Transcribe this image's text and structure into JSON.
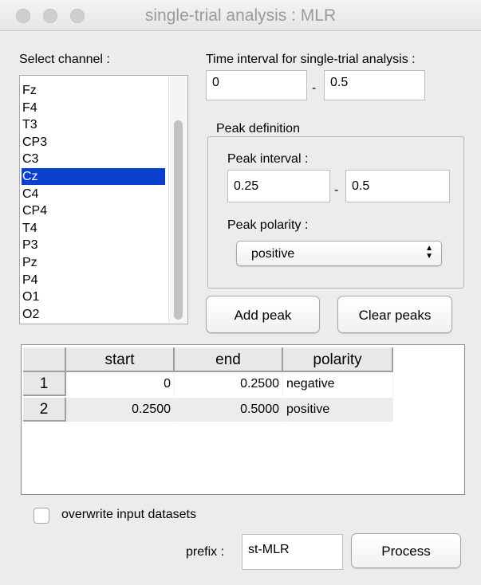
{
  "window": {
    "title": "single-trial analysis : MLR"
  },
  "channel": {
    "label": "Select channel :",
    "items": [
      "Fz",
      "F4",
      "T3",
      "CP3",
      "C3",
      "Cz",
      "C4",
      "CP4",
      "T4",
      "P3",
      "Pz",
      "P4",
      "O1",
      "O2"
    ],
    "selected": "Cz"
  },
  "time_interval": {
    "label": "Time interval for single-trial analysis :",
    "start": "0",
    "separator": "-",
    "end": "0.5"
  },
  "peak_definition": {
    "title": "Peak definition",
    "interval_label": "Peak interval :",
    "interval_start": "0.25",
    "separator": "-",
    "interval_end": "0.5",
    "polarity_label": "Peak polarity :",
    "polarity_value": "positive"
  },
  "buttons": {
    "add_peak": "Add peak",
    "clear_peaks": "Clear peaks",
    "process": "Process"
  },
  "table": {
    "columns": [
      "start",
      "end",
      "polarity"
    ],
    "rows": [
      {
        "index": "1",
        "start": "0",
        "end": "0.2500",
        "polarity": "negative"
      },
      {
        "index": "2",
        "start": "0.2500",
        "end": "0.5000",
        "polarity": "positive"
      }
    ]
  },
  "overwrite": {
    "label": "overwrite input datasets",
    "checked": false
  },
  "prefix": {
    "label": "prefix :",
    "value": "st-MLR"
  },
  "colors": {
    "selection": "#0a3fd0"
  }
}
